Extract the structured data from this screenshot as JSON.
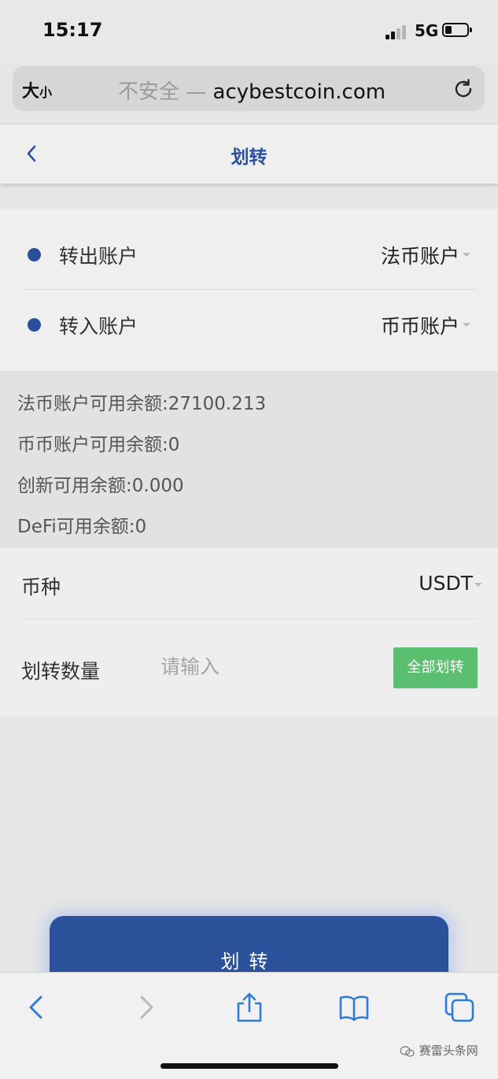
{
  "status_bar": {
    "time": "15:17",
    "network": "5G"
  },
  "address_bar": {
    "text_size_large": "大",
    "text_size_small": "小",
    "insecure_label": "不安全 — ",
    "domain": "acybestcoin.com"
  },
  "nav": {
    "title": "划转"
  },
  "transfer": {
    "from_label": "转出账户",
    "from_value": "法币账户",
    "to_label": "转入账户",
    "to_value": "币币账户"
  },
  "balances": [
    "法币账户可用余额:27100.213",
    "币币账户可用余额:0",
    "创新可用余额:0.000",
    "DeFi可用余额:0"
  ],
  "form": {
    "coin_label": "币种",
    "coin_value": "USDT",
    "amount_label": "划转数量",
    "amount_placeholder": "请输入",
    "all_button": "全部划转"
  },
  "submit_label": "划转",
  "watermark": "赛雷头条网",
  "icons": [
    "back-arrow-icon",
    "forward-arrow-icon",
    "share-icon",
    "bookmarks-icon",
    "tabs-icon",
    "reload-icon",
    "chevron-left-icon"
  ]
}
